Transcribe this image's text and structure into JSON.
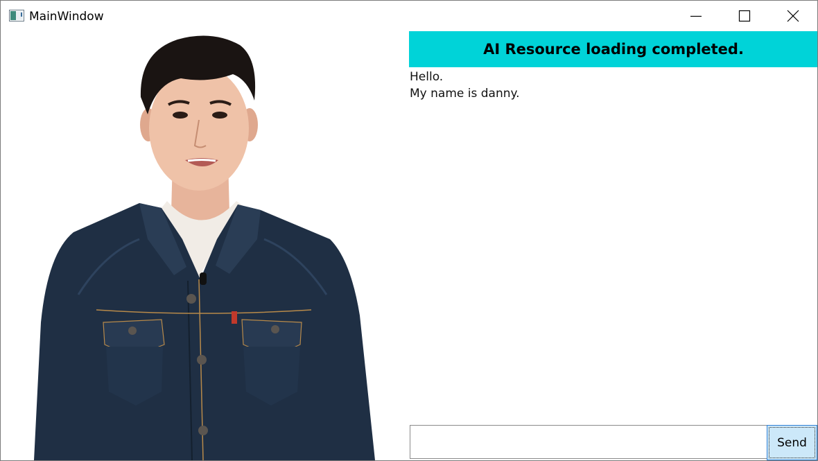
{
  "window": {
    "title": "MainWindow",
    "icons": {
      "app": "window-app-icon",
      "minimize": "minimize-icon",
      "maximize": "maximize-icon",
      "close": "close-icon"
    }
  },
  "status": {
    "text": "AI Resource loading completed."
  },
  "colors": {
    "banner": "#00d3d8",
    "send_button": "#cce8f9",
    "send_button_border": "#2f7fd4",
    "jacket": "#1f2f44"
  },
  "chat": {
    "lines": [
      "Hello.",
      "My name is danny."
    ]
  },
  "input": {
    "value": "",
    "placeholder": ""
  },
  "send": {
    "label": "Send"
  }
}
